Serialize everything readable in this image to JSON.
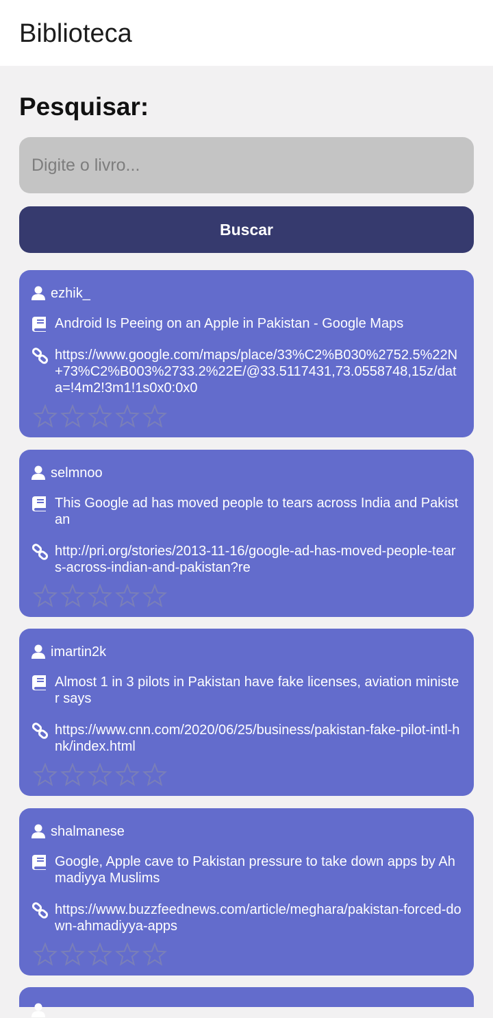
{
  "app_bar": {
    "title": "Biblioteca"
  },
  "search": {
    "heading": "Pesquisar:",
    "placeholder": "Digite o livro...",
    "value": "",
    "button_label": "Buscar"
  },
  "icons": {
    "user": "user-icon",
    "book": "book-icon",
    "link": "link-icon",
    "star": "star-outline-icon"
  },
  "colors": {
    "card_background": "#636ccc",
    "button_background": "#363a6e",
    "input_background": "#c4c4c4",
    "star_outline": "#7a7fb8"
  },
  "results": [
    {
      "user": "ezhik_",
      "title": "Android Is Peeing on an Apple in Pakistan - Google Maps",
      "link": "https://www.google.com/maps/place/33%C2%B030%2752.5%22N+73%C2%B003%2733.2%22E/@33.5117431,73.0558748,15z/data=!4m2!3m1!1s0x0:0x0",
      "rating": 0
    },
    {
      "user": "selmnoo",
      "title": "This Google ad has moved people to tears across India and Pakistan",
      "link": "http://pri.org/stories/2013-11-16/google-ad-has-moved-people-tears-across-indian-and-pakistan?re",
      "rating": 0
    },
    {
      "user": "imartin2k",
      "title": "Almost 1 in 3 pilots in Pakistan have fake licenses, aviation minister says",
      "link": "https://www.cnn.com/2020/06/25/business/pakistan-fake-pilot-intl-hnk/index.html",
      "rating": 0
    },
    {
      "user": "shalmanese",
      "title": "Google, Apple cave to Pakistan pressure to take down apps by Ahmadiyya Muslims",
      "link": "https://www.buzzfeednews.com/article/meghara/pakistan-forced-down-ahmadiyya-apps",
      "rating": 0
    }
  ]
}
